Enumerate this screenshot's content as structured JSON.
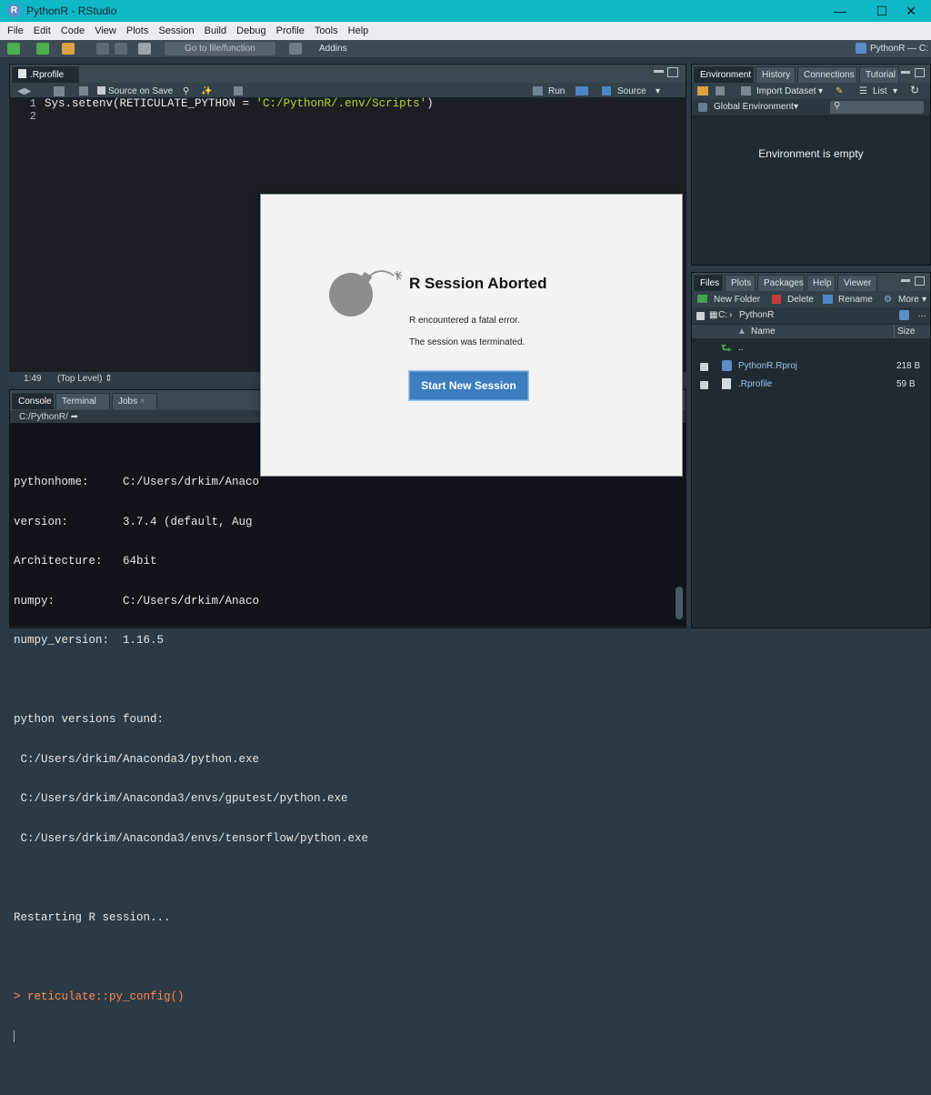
{
  "window": {
    "title": "PythonR - RStudio",
    "app_icon": "R"
  },
  "menu": [
    "File",
    "Edit",
    "Code",
    "View",
    "Plots",
    "Session",
    "Build",
    "Debug",
    "Profile",
    "Tools",
    "Help"
  ],
  "toolbar": {
    "goto_placeholder": "Go to file/function",
    "addins": "Addins",
    "project": "PythonR — C:"
  },
  "editor": {
    "tab": ".Rprofile",
    "source_on_save": "Source on Save",
    "run": "Run",
    "source": "Source",
    "line_numbers": [
      "1",
      "2"
    ],
    "code_prefix": "Sys.setenv(RETICULATE_PYTHON = ",
    "code_string": "'C:/PythonR/.env/Scripts'",
    "code_suffix": ")",
    "cursor_pos": "1:49",
    "scope": "(Top Level)"
  },
  "console": {
    "tabs": [
      "Console",
      "Terminal",
      "Jobs"
    ],
    "path": "C:/PythonR/",
    "lines": [
      "pythonhome:     C:/Users/drkim/Anaco",
      "version:        3.7.4 (default, Aug",
      "Architecture:   64bit",
      "numpy:          C:/Users/drkim/Anaco",
      "numpy_version:  1.16.5",
      "",
      "python versions found:",
      " C:/Users/drkim/Anaconda3/python.exe",
      " C:/Users/drkim/Anaconda3/envs/gputest/python.exe",
      " C:/Users/drkim/Anaconda3/envs/tensorflow/python.exe",
      "",
      "Restarting R session...",
      ""
    ],
    "prompt": "> reticulate::py_config()"
  },
  "environment": {
    "tabs": [
      "Environment",
      "History",
      "Connections",
      "Tutorial"
    ],
    "import_dataset": "Import Dataset",
    "list_view": "List",
    "scope": "Global Environment",
    "empty_message": "Environment is empty"
  },
  "files": {
    "tabs": [
      "Files",
      "Plots",
      "Packages",
      "Help",
      "Viewer"
    ],
    "new_folder": "New Folder",
    "delete": "Delete",
    "rename": "Rename",
    "more": "More",
    "breadcrumb_root": "C:",
    "breadcrumb_folder": "PythonR",
    "col_name": "Name",
    "col_size": "Size",
    "parent": "..",
    "items": [
      {
        "name": "PythonR.Rproj",
        "size": "218 B"
      },
      {
        "name": ".Rprofile",
        "size": "59 B"
      }
    ]
  },
  "dialog": {
    "title": "R Session Aborted",
    "line1": "R encountered a fatal error.",
    "line2": "The session was terminated.",
    "button": "Start New Session"
  },
  "colors": {
    "titlebar": "#0fb8c4",
    "accent_button": "#3b7dbf",
    "string": "#b5d334",
    "prompt": "#ff8a4c"
  }
}
